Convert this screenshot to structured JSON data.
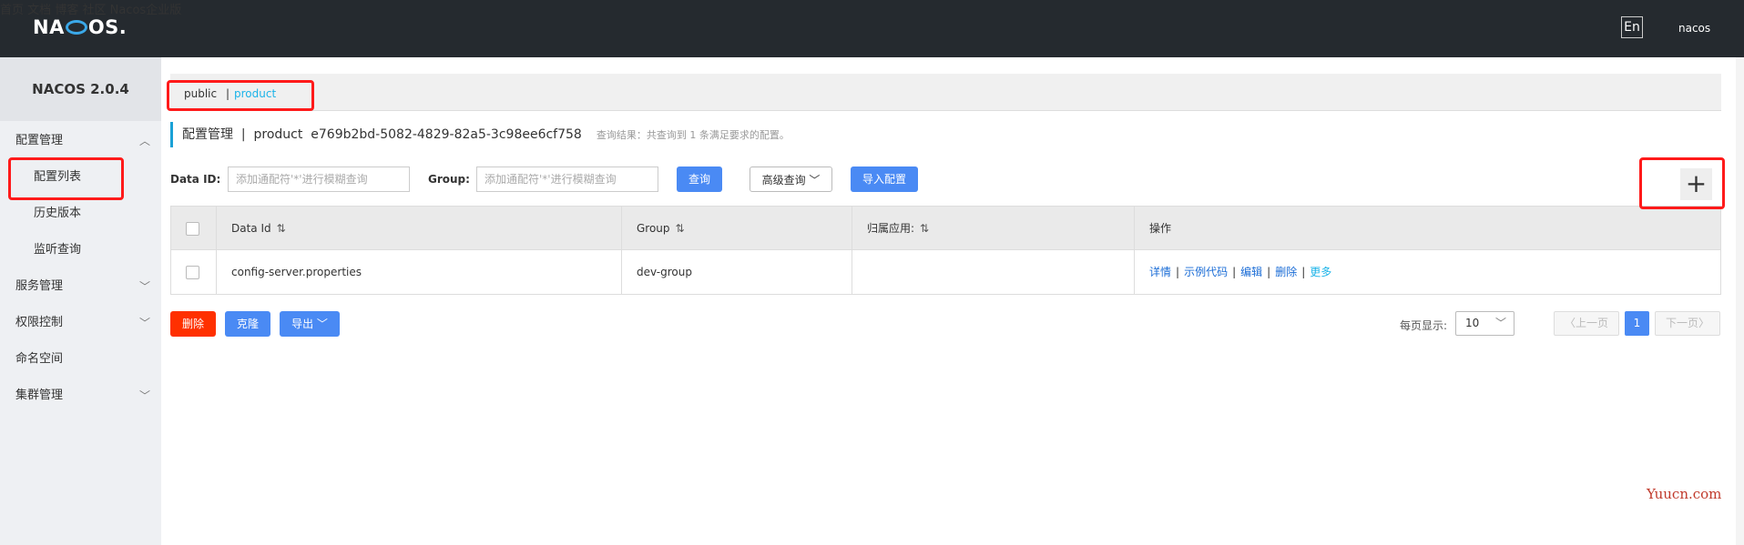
{
  "header": {
    "logo_text_left": "NA",
    "logo_text_right": "OS.",
    "nav": [
      "首页",
      "文档",
      "博客",
      "社区",
      "Nacos企业版"
    ],
    "lang": "En",
    "user": "nacos"
  },
  "sidebar": {
    "version": "NACOS 2.0.4",
    "items": [
      {
        "label": "配置管理"
      },
      {
        "label": "配置列表"
      },
      {
        "label": "历史版本"
      },
      {
        "label": "监听查询"
      },
      {
        "label": "服务管理"
      },
      {
        "label": "权限控制"
      },
      {
        "label": "命名空间"
      },
      {
        "label": "集群管理"
      }
    ]
  },
  "namespace": {
    "public": "public",
    "sep": "|",
    "product": "product"
  },
  "title": {
    "main": "配置管理  |  product  e769b2bd-5082-4829-82a5-3c98ee6cf758",
    "hint": "查询结果：共查询到 1 条满足要求的配置。"
  },
  "search": {
    "dataid_label": "Data ID:",
    "dataid_placeholder": "添加通配符'*'进行模糊查询",
    "group_label": "Group:",
    "group_placeholder": "添加通配符'*'进行模糊查询",
    "query_btn": "查询",
    "advanced_btn": "高级查询",
    "import_btn": "导入配置",
    "plus": "+"
  },
  "table": {
    "headers": [
      "Data Id",
      "Group",
      "归属应用:",
      "操作"
    ],
    "sort_icon": "⇅",
    "rows": [
      {
        "data_id": "config-server.properties",
        "group": "dev-group",
        "app": ""
      }
    ],
    "ops": [
      "详情",
      "示例代码",
      "编辑",
      "删除",
      "更多"
    ]
  },
  "actions": {
    "delete": "删除",
    "clone": "克隆",
    "export": "导出"
  },
  "pagination": {
    "label": "每页显示:",
    "page_size": "10",
    "prev": "上一页",
    "next": "下一页",
    "current": "1"
  },
  "watermark": "Yuucn.com",
  "colors": {
    "header_bg": "#252a2f",
    "primary": "#4a8af4",
    "danger": "#ff3000",
    "highlight": "#ff1a1a",
    "link": "#1a6cd6"
  }
}
